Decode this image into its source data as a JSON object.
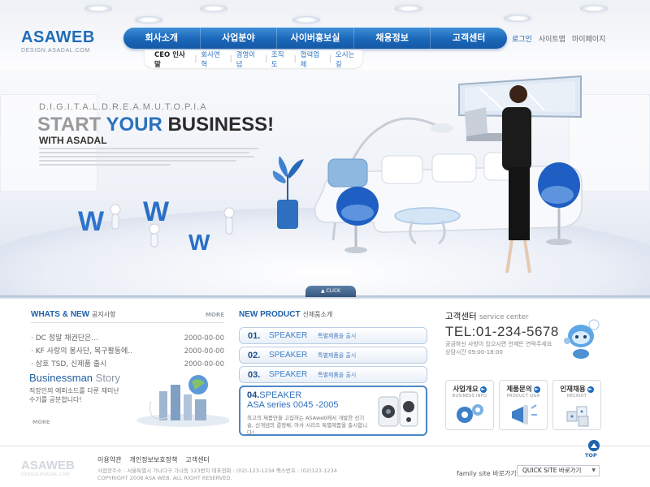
{
  "brand": {
    "logo": "ASAWEB",
    "logo_sub": "DESIGN.ASADAL.COM"
  },
  "gnb": [
    "회사소개",
    "사업분야",
    "사이버홍보실",
    "채용정보",
    "고객센터"
  ],
  "util": [
    "로그인",
    "사이트맵",
    "마이페이지"
  ],
  "subnav": [
    "CEO 인사말",
    "회사연혁",
    "경영이념",
    "조직도",
    "협력업체",
    "오시는 길"
  ],
  "hero": {
    "tag": "D.I.G.I.T.A.L.D.R.E.A.M.U.T.O.P.I.A",
    "title_part1": "START ",
    "title_part2": "YOUR ",
    "title_part3": "BUSINESS!",
    "with": "WITH ASADAL",
    "click": "CLICK",
    "www": "W"
  },
  "news": {
    "title": "WHATS & NEW",
    "title_kr": "공지사항",
    "more": "MORE",
    "items": [
      {
        "text": "· DC 정말 채권단은...",
        "date": "2000-00-00"
      },
      {
        "text": "· KF 사랑의 봉사단, 복구활동에..",
        "date": "2000-00-00"
      },
      {
        "text": "· 삼호 TSD, 신제품 출시",
        "date": "2000-00-00"
      }
    ]
  },
  "biz": {
    "title1": "Businessman",
    "title2": "Story",
    "desc": "직장인의 에피소드를 다룬 재미난 수기를 공분합니다!",
    "more": "MORE"
  },
  "products": {
    "title": "NEW PRODUCT",
    "title_kr": "신제품소개",
    "items": [
      {
        "num": "01.",
        "name": "SPEAKER",
        "sub": "특별제품을 출시"
      },
      {
        "num": "02.",
        "name": "SPEAKER",
        "sub": "특별제품을 출시"
      },
      {
        "num": "03.",
        "name": "SPEAKER",
        "sub": "특별제품을 출시"
      }
    ],
    "feature": {
      "num": "04.",
      "name": "SPEAKER",
      "sub": "ASA series 0045 -2005",
      "desc": "최고의 제품만을 고집하는 ASAweb에서 개발한 신기술, 신개념의 결정체, 아사 시리즈 특별제품을 출시합니다!"
    }
  },
  "cs": {
    "title": "고객센터",
    "title_en": "service center",
    "tel": "TEL:01-234-5678",
    "desc1": "궁금하신 사항이 있으시면 언제든 연락주세요",
    "desc2": "상담시간 09:00-18:00"
  },
  "quick": [
    {
      "kr": "사업개요",
      "en": "BUSINESS INFO"
    },
    {
      "kr": "제품문의",
      "en": "PRODUCT Q&A"
    },
    {
      "kr": "인재채용",
      "en": "RECRUIT"
    }
  ],
  "footer": {
    "logo": "ASAWEB",
    "logo_sub": "DESIGN.ASADAL.COM",
    "links": [
      "이용약관",
      "개인정보보호정책",
      "고객센터"
    ],
    "address": "사업장주소 : 서울특별시 가나다구 가나동 123번지   대표전화 : (02)-123-1234   팩스번호 : (02)123-1234",
    "copyright": "COPYRIGHT 2008 ASA WEB. ALL RIGHT RESERVED.",
    "top": "TOP",
    "family_label": "family site 바로가기",
    "family_select": "QUICK SITE 바로가기"
  },
  "colors": {
    "primary": "#1a66b8",
    "accent": "#2a72bd",
    "background": "#ffffff"
  }
}
